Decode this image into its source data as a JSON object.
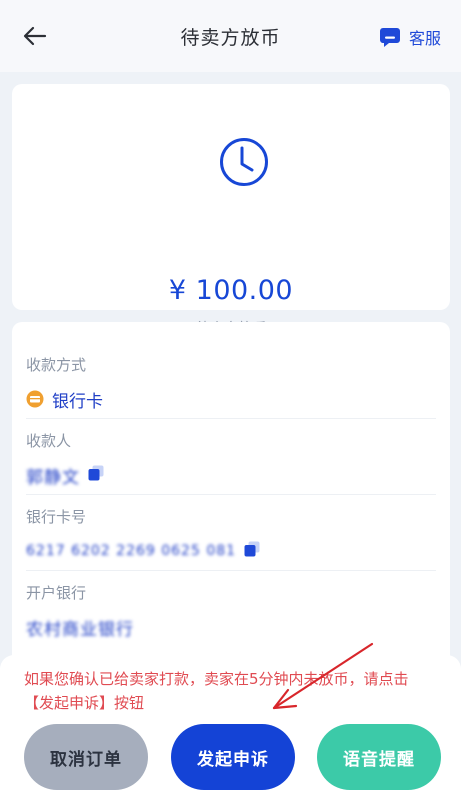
{
  "header": {
    "title": "待卖方放币",
    "service_label": "客服"
  },
  "status_card": {
    "amount": "¥ 100.00",
    "status_text": "待卖方放币"
  },
  "payment_info": {
    "method_label": "收款方式",
    "method_value": "银行卡",
    "payee_label": "收款人",
    "payee_value": "郭静文",
    "card_label": "银行卡号",
    "card_value": "6217 6202 2269 0625 081",
    "bank_label": "开户银行",
    "bank_value": "农村商业银行"
  },
  "footer": {
    "notice": "如果您确认已给卖家打款，卖家在5分钟内未放币，请点击【发起申诉】按钮",
    "cancel_label": "取消订单",
    "appeal_label": "发起申诉",
    "voice_label": "语音提醒"
  },
  "colors": {
    "primary": "#1443d6",
    "notice": "#e04b52",
    "voice_button": "#3ccaa8",
    "cancel_button": "#a6aebd",
    "bank_icon": "#f0a030"
  }
}
